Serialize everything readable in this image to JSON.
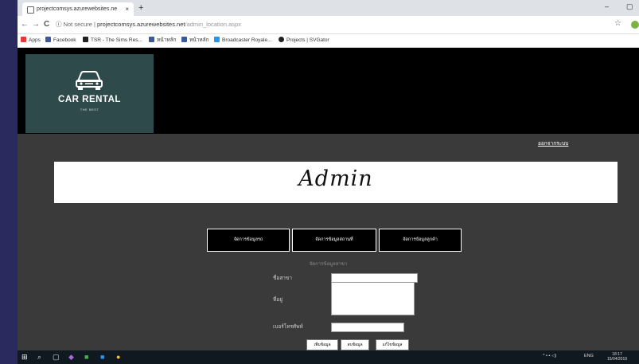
{
  "browser": {
    "tab_title": "projectcomsys.azurewebsites.ne",
    "tab_close": "×",
    "new_tab": "+",
    "minimize": "–",
    "restore": "▢",
    "back": "←",
    "forward": "→",
    "reload": "C",
    "secure_label": "Not secure",
    "url_host": "projectcomsys.azurewebsites.net",
    "url_path": "/admin_location.aspx",
    "star": "☆",
    "bookmarks": [
      {
        "label": "Apps",
        "color": "#e53935"
      },
      {
        "label": "Facebook",
        "color": "#3b5998"
      },
      {
        "label": "TSR - The Sims Res...",
        "color": "#222222"
      },
      {
        "label": "หน้าหลัก",
        "color": "#3b5998"
      },
      {
        "label": "หน้าหลัก",
        "color": "#3b5998"
      },
      {
        "label": "Broadcaster Royale...",
        "color": "#2196f3"
      },
      {
        "label": "Projects | SVGator",
        "color": "#222222"
      }
    ]
  },
  "site": {
    "logo_brand": "CAR RENTAL",
    "logo_tagline": "THE BEST",
    "logout_label": "ออกจากระบบ",
    "banner_title": "Admin",
    "menu": [
      {
        "label": "จัดการข้อมูลรถ"
      },
      {
        "label": "จัดการข้อมูลสถานที่"
      },
      {
        "label": "จัดการข้อมูลลูกค้า"
      }
    ],
    "section_title": "จัดการข้อมูลสาขา",
    "form": {
      "branch_name_label": "ชื่อสาขา",
      "address_label": "ที่อยู่",
      "phone_label": "เบอร์โทรศัพท์",
      "branch_name_value": "",
      "address_value": "",
      "phone_value": ""
    },
    "buttons": [
      {
        "label": "เพิ่มข้อมูล"
      },
      {
        "label": "ลบข้อมูล"
      },
      {
        "label": "แก้ไขข้อมูล"
      }
    ]
  },
  "taskbar": {
    "tray_text": "ENG",
    "time": "18:17",
    "date": "15/04/2019"
  },
  "colors": {
    "logo_bg": "#2e4a4a",
    "page_bg": "#3a3a3a",
    "frame": "#2a2a5e"
  }
}
